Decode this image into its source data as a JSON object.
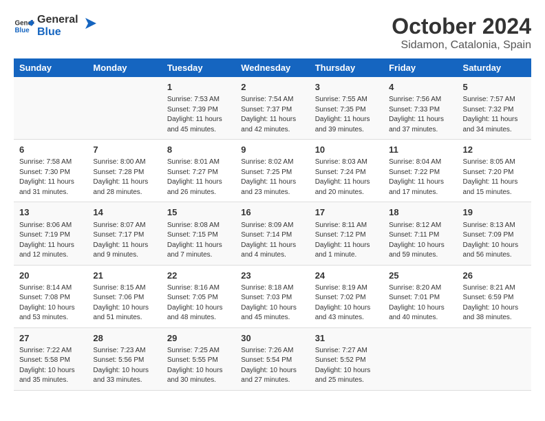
{
  "header": {
    "logo_general": "General",
    "logo_blue": "Blue",
    "title": "October 2024",
    "subtitle": "Sidamon, Catalonia, Spain"
  },
  "columns": [
    "Sunday",
    "Monday",
    "Tuesday",
    "Wednesday",
    "Thursday",
    "Friday",
    "Saturday"
  ],
  "weeks": [
    [
      {
        "day": "",
        "sunrise": "",
        "sunset": "",
        "daylight": ""
      },
      {
        "day": "",
        "sunrise": "",
        "sunset": "",
        "daylight": ""
      },
      {
        "day": "1",
        "sunrise": "Sunrise: 7:53 AM",
        "sunset": "Sunset: 7:39 PM",
        "daylight": "Daylight: 11 hours and 45 minutes."
      },
      {
        "day": "2",
        "sunrise": "Sunrise: 7:54 AM",
        "sunset": "Sunset: 7:37 PM",
        "daylight": "Daylight: 11 hours and 42 minutes."
      },
      {
        "day": "3",
        "sunrise": "Sunrise: 7:55 AM",
        "sunset": "Sunset: 7:35 PM",
        "daylight": "Daylight: 11 hours and 39 minutes."
      },
      {
        "day": "4",
        "sunrise": "Sunrise: 7:56 AM",
        "sunset": "Sunset: 7:33 PM",
        "daylight": "Daylight: 11 hours and 37 minutes."
      },
      {
        "day": "5",
        "sunrise": "Sunrise: 7:57 AM",
        "sunset": "Sunset: 7:32 PM",
        "daylight": "Daylight: 11 hours and 34 minutes."
      }
    ],
    [
      {
        "day": "6",
        "sunrise": "Sunrise: 7:58 AM",
        "sunset": "Sunset: 7:30 PM",
        "daylight": "Daylight: 11 hours and 31 minutes."
      },
      {
        "day": "7",
        "sunrise": "Sunrise: 8:00 AM",
        "sunset": "Sunset: 7:28 PM",
        "daylight": "Daylight: 11 hours and 28 minutes."
      },
      {
        "day": "8",
        "sunrise": "Sunrise: 8:01 AM",
        "sunset": "Sunset: 7:27 PM",
        "daylight": "Daylight: 11 hours and 26 minutes."
      },
      {
        "day": "9",
        "sunrise": "Sunrise: 8:02 AM",
        "sunset": "Sunset: 7:25 PM",
        "daylight": "Daylight: 11 hours and 23 minutes."
      },
      {
        "day": "10",
        "sunrise": "Sunrise: 8:03 AM",
        "sunset": "Sunset: 7:24 PM",
        "daylight": "Daylight: 11 hours and 20 minutes."
      },
      {
        "day": "11",
        "sunrise": "Sunrise: 8:04 AM",
        "sunset": "Sunset: 7:22 PM",
        "daylight": "Daylight: 11 hours and 17 minutes."
      },
      {
        "day": "12",
        "sunrise": "Sunrise: 8:05 AM",
        "sunset": "Sunset: 7:20 PM",
        "daylight": "Daylight: 11 hours and 15 minutes."
      }
    ],
    [
      {
        "day": "13",
        "sunrise": "Sunrise: 8:06 AM",
        "sunset": "Sunset: 7:19 PM",
        "daylight": "Daylight: 11 hours and 12 minutes."
      },
      {
        "day": "14",
        "sunrise": "Sunrise: 8:07 AM",
        "sunset": "Sunset: 7:17 PM",
        "daylight": "Daylight: 11 hours and 9 minutes."
      },
      {
        "day": "15",
        "sunrise": "Sunrise: 8:08 AM",
        "sunset": "Sunset: 7:15 PM",
        "daylight": "Daylight: 11 hours and 7 minutes."
      },
      {
        "day": "16",
        "sunrise": "Sunrise: 8:09 AM",
        "sunset": "Sunset: 7:14 PM",
        "daylight": "Daylight: 11 hours and 4 minutes."
      },
      {
        "day": "17",
        "sunrise": "Sunrise: 8:11 AM",
        "sunset": "Sunset: 7:12 PM",
        "daylight": "Daylight: 11 hours and 1 minute."
      },
      {
        "day": "18",
        "sunrise": "Sunrise: 8:12 AM",
        "sunset": "Sunset: 7:11 PM",
        "daylight": "Daylight: 10 hours and 59 minutes."
      },
      {
        "day": "19",
        "sunrise": "Sunrise: 8:13 AM",
        "sunset": "Sunset: 7:09 PM",
        "daylight": "Daylight: 10 hours and 56 minutes."
      }
    ],
    [
      {
        "day": "20",
        "sunrise": "Sunrise: 8:14 AM",
        "sunset": "Sunset: 7:08 PM",
        "daylight": "Daylight: 10 hours and 53 minutes."
      },
      {
        "day": "21",
        "sunrise": "Sunrise: 8:15 AM",
        "sunset": "Sunset: 7:06 PM",
        "daylight": "Daylight: 10 hours and 51 minutes."
      },
      {
        "day": "22",
        "sunrise": "Sunrise: 8:16 AM",
        "sunset": "Sunset: 7:05 PM",
        "daylight": "Daylight: 10 hours and 48 minutes."
      },
      {
        "day": "23",
        "sunrise": "Sunrise: 8:18 AM",
        "sunset": "Sunset: 7:03 PM",
        "daylight": "Daylight: 10 hours and 45 minutes."
      },
      {
        "day": "24",
        "sunrise": "Sunrise: 8:19 AM",
        "sunset": "Sunset: 7:02 PM",
        "daylight": "Daylight: 10 hours and 43 minutes."
      },
      {
        "day": "25",
        "sunrise": "Sunrise: 8:20 AM",
        "sunset": "Sunset: 7:01 PM",
        "daylight": "Daylight: 10 hours and 40 minutes."
      },
      {
        "day": "26",
        "sunrise": "Sunrise: 8:21 AM",
        "sunset": "Sunset: 6:59 PM",
        "daylight": "Daylight: 10 hours and 38 minutes."
      }
    ],
    [
      {
        "day": "27",
        "sunrise": "Sunrise: 7:22 AM",
        "sunset": "Sunset: 5:58 PM",
        "daylight": "Daylight: 10 hours and 35 minutes."
      },
      {
        "day": "28",
        "sunrise": "Sunrise: 7:23 AM",
        "sunset": "Sunset: 5:56 PM",
        "daylight": "Daylight: 10 hours and 33 minutes."
      },
      {
        "day": "29",
        "sunrise": "Sunrise: 7:25 AM",
        "sunset": "Sunset: 5:55 PM",
        "daylight": "Daylight: 10 hours and 30 minutes."
      },
      {
        "day": "30",
        "sunrise": "Sunrise: 7:26 AM",
        "sunset": "Sunset: 5:54 PM",
        "daylight": "Daylight: 10 hours and 27 minutes."
      },
      {
        "day": "31",
        "sunrise": "Sunrise: 7:27 AM",
        "sunset": "Sunset: 5:52 PM",
        "daylight": "Daylight: 10 hours and 25 minutes."
      },
      {
        "day": "",
        "sunrise": "",
        "sunset": "",
        "daylight": ""
      },
      {
        "day": "",
        "sunrise": "",
        "sunset": "",
        "daylight": ""
      }
    ]
  ]
}
